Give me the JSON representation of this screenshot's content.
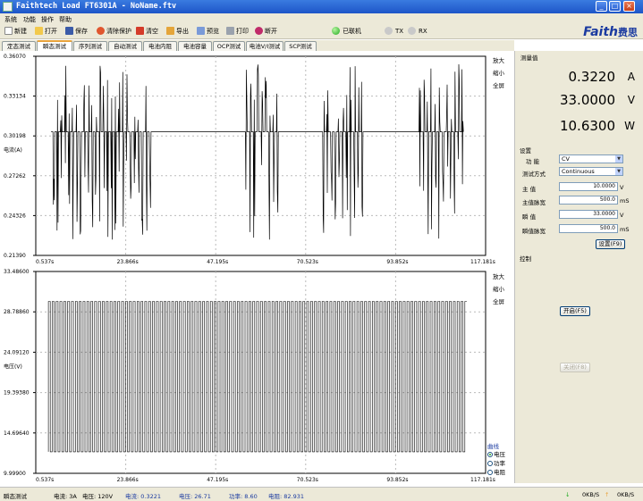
{
  "window": {
    "title": "Faithtech Load FT6301A - NoName.ftv"
  },
  "menu": [
    "系统",
    "功能",
    "操作",
    "帮助"
  ],
  "toolbar": {
    "items": [
      "新建",
      "打开",
      "保存",
      "清除保护",
      "清空",
      "导出",
      "预览",
      "打印",
      "断开"
    ],
    "connection": "已联机",
    "tx": "TX",
    "rx": "RX"
  },
  "brand": {
    "latin": "Faith",
    "cn": "费思"
  },
  "tabs": [
    "定态测试",
    "瞬态测试",
    "序列测试",
    "自动测试",
    "电池内阻",
    "电池容量",
    "OCP测试",
    "电池V/I测试",
    "SCP测试"
  ],
  "top_chart_side": [
    "放大",
    "缩小",
    "全屏"
  ],
  "bottom_chart_side": [
    "放大",
    "缩小",
    "全屏"
  ],
  "measurement": {
    "title": "测量值",
    "current": {
      "value": "0.3220",
      "unit": "A"
    },
    "voltage": {
      "value": "33.0000",
      "unit": "V"
    },
    "power": {
      "value": "10.6300",
      "unit": "W"
    }
  },
  "settings": {
    "title": "设置",
    "function_label": "功    能",
    "function_value": "CV",
    "mode_label": "测试方式",
    "mode_value": "Continuous",
    "main_value_label": "主    值",
    "main_value": "10.0000",
    "main_value_unit": "V",
    "main_width_label": "主值脉宽",
    "main_width": "500.0",
    "main_width_unit": "mS",
    "trans_value_label": "瞬    值",
    "trans_value": "33.0000",
    "trans_value_unit": "V",
    "trans_width_label": "瞬值脉宽",
    "trans_width": "500.0",
    "trans_width_unit": "mS",
    "set_button": "设置(F9)"
  },
  "control": {
    "title": "控制",
    "start_button": "开启(F5)",
    "stop_button": "关闭(F8)"
  },
  "curve_select": {
    "title": "曲线",
    "options": [
      "电压",
      "功率",
      "电阻"
    ],
    "selected": "电压"
  },
  "status": {
    "mode": "瞬态测试",
    "current_range": "电流: 3A",
    "voltage_range": "电压: 120V",
    "current_reading": "电流: 0.3221",
    "voltage_reading": "电压: 26.71",
    "power_reading": "功率: 8.60",
    "resistance_reading": "电阻: 82.931",
    "rx_rate": "0KB/S",
    "tx_rate": "0KB/S"
  },
  "chart_data": [
    {
      "type": "line",
      "ylabel": "电流(A)",
      "ylim": [
        0.2139,
        0.3607
      ],
      "y_ticks": [
        "0.36070",
        "0.33134",
        "0.30198",
        "0.27262",
        "0.24326",
        "0.21390"
      ],
      "x_ticks": [
        "0.537s",
        "23.866s",
        "47.195s",
        "70.523s",
        "93.852s",
        "117.181s"
      ],
      "xlim": [
        0.537,
        117.181
      ],
      "baseline": 0.305,
      "bursts": [
        {
          "start": 5,
          "end": 31
        },
        {
          "start": 55,
          "end": 64
        },
        {
          "start": 75,
          "end": 86
        },
        {
          "start": 100,
          "end": 112
        }
      ]
    },
    {
      "type": "line",
      "ylabel": "电压(V)",
      "ylim": [
        9.999,
        33.486
      ],
      "y_ticks": [
        "33.48600",
        "28.78860",
        "24.09120",
        "19.39380",
        "14.69640",
        "9.99900"
      ],
      "x_ticks": [
        "0.537s",
        "23.866s",
        "47.195s",
        "70.523s",
        "93.852s",
        "117.181s"
      ],
      "xlim": [
        0.537,
        117.181
      ],
      "high": 30.0,
      "low": 12.5,
      "period": 1.0
    }
  ]
}
